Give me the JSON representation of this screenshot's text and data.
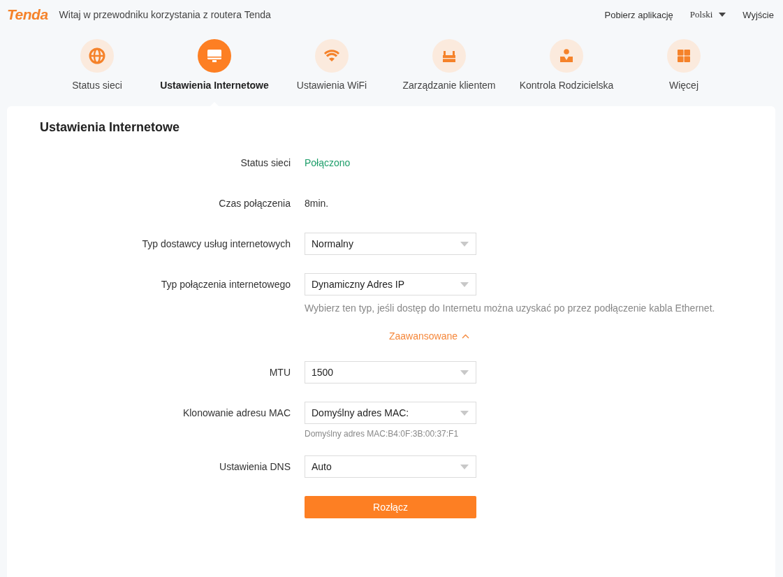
{
  "header": {
    "logo": "Tenda",
    "welcome": "Witaj w przewodniku korzystania z routera Tenda",
    "links": [
      {
        "label": "Pobierz aplikację",
        "kind": "link"
      },
      {
        "label": "Polski",
        "kind": "dropdown"
      },
      {
        "label": "Wyjście",
        "kind": "link"
      }
    ]
  },
  "nav": [
    {
      "label": "Status sieci",
      "selected": false
    },
    {
      "label": "Ustawienia Internetowe",
      "selected": true
    },
    {
      "label": "Ustawienia WiFi",
      "selected": false
    },
    {
      "label": "Zarządzanie klientem",
      "selected": false
    },
    {
      "label": "Kontrola Rodzicielska",
      "selected": false
    },
    {
      "label": "Więcej",
      "selected": false
    }
  ],
  "panel": {
    "title": "Ustawienia Internetowe",
    "rows": [
      {
        "kind": "status",
        "label": "Status sieci",
        "value": "Połączono"
      },
      {
        "kind": "text",
        "label": "Czas połączenia",
        "value": "8min."
      },
      {
        "kind": "select",
        "label": "Typ dostawcy usług internetowych",
        "value": "Normalny"
      },
      {
        "kind": "select",
        "label": "Typ połączenia internetowego",
        "value": "Dynamiczny Adres IP",
        "hint": {
          "kind": "help",
          "text": "Wybierz ten typ, jeśli dostęp do Internetu można uzyskać po przez podłączenie kabla Ethernet."
        }
      },
      {
        "kind": "toggle",
        "label": "Zaawansowane",
        "expanded": true
      },
      {
        "kind": "select",
        "label": "MTU",
        "value": "1500"
      },
      {
        "kind": "select",
        "label": "Klonowanie adresu MAC",
        "value": "Domyślny adres MAC:",
        "hint": {
          "kind": "note",
          "text": "Domyślny adres MAC:B4:0F:3B:00:37:F1"
        }
      },
      {
        "kind": "select",
        "label": "Ustawienia DNS",
        "value": "Auto"
      },
      {
        "kind": "button",
        "label": "Rozłącz"
      }
    ]
  }
}
